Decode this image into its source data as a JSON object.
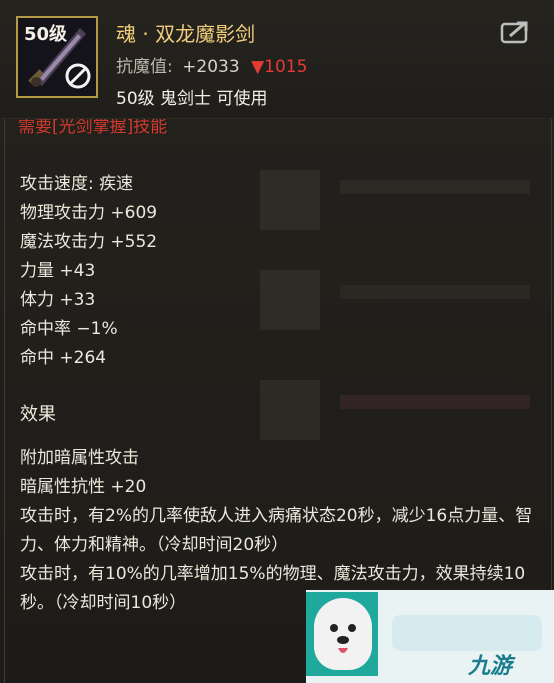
{
  "item": {
    "level_badge": "50级",
    "name": "魂 · 双龙魔影剑",
    "resist_label": "抗魔值:",
    "resist_value": "+2033",
    "resist_diff": "▼1015",
    "requirement": "50级 鬼剑士 可使用",
    "cut_off_text": "需要[光剑掌握]技能"
  },
  "colors": {
    "name": "#f0cd7a",
    "diff": "#e53b35",
    "icon_border": "#b49a45",
    "watermark_teal": "#1fa99d"
  },
  "icons": {
    "item": "sword-icon",
    "lock": "prohibited-icon",
    "share": "share-icon"
  },
  "stats": [
    "攻击速度: 疾速",
    "物理攻击力 +609",
    "魔法攻击力 +552",
    "力量 +43",
    "体力 +33",
    "命中率 −1%",
    "命中 +264"
  ],
  "effect_title": "效果",
  "effects": [
    "附加暗属性攻击",
    "暗属性抗性 +20",
    "攻击时，有2%的几率使敌人进入病痛状态20秒，减少16点力量、智力、体力和精神。（冷却时间20秒）",
    "攻击时，有10%的几率增加15%的物理、魔法攻击力，效果持续10秒。（冷却时间10秒）"
  ],
  "watermark": {
    "brand": "九游"
  }
}
